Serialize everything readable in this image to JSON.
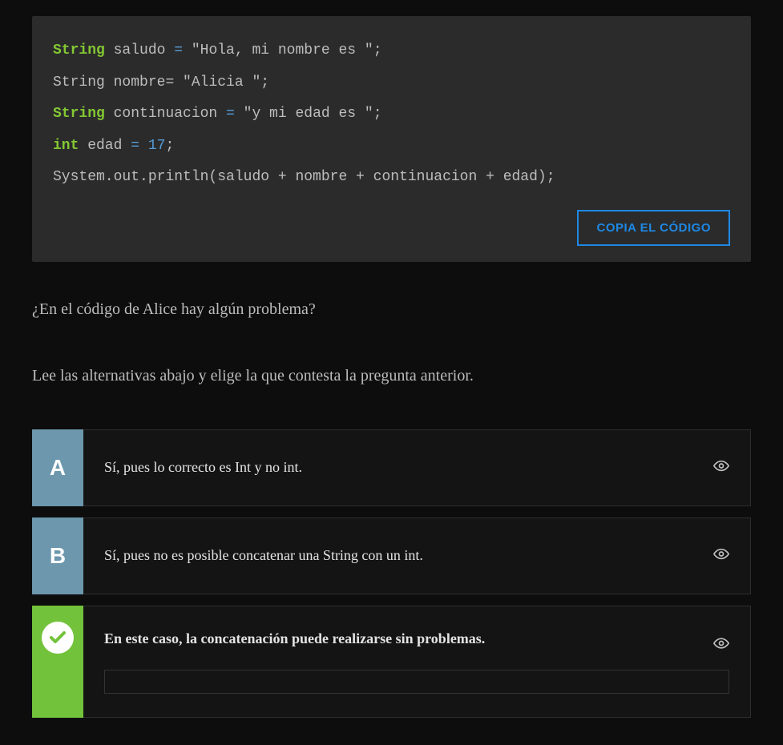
{
  "code": {
    "t_string_a": "String",
    "v_saludo": " saludo",
    "eq_a": " = ",
    "s_saludo": "\"Hola, mi nombre es \"",
    "semi": ";",
    "t_string_b": "String",
    "v_nombre": " nombre",
    "eq_plain": "= ",
    "s_nombre": "\"Alicia \"",
    "t_string_c": "String",
    "v_cont": " continuacion",
    "eq_c": " = ",
    "s_cont": "\"y mi edad es \"",
    "t_int": "int",
    "v_edad": " edad",
    "eq_d": " = ",
    "n_edad": "17",
    "println": "System.out.println(saludo + nombre + continuacion + edad);",
    "copy_label": "COPIA EL CÓDIGO"
  },
  "question": "¿En el código de Alice hay algún problema?",
  "instruction": "Lee las alternativas abajo y elige la que contesta la pregunta anterior.",
  "choices": {
    "a": {
      "letter": "A",
      "text": "Sí, pues lo correcto es Int y no int."
    },
    "b": {
      "letter": "B",
      "text": "Sí, pues no es posible concatenar una String con un int."
    },
    "c": {
      "text": "En este caso, la concatenación puede realizarse sin problemas."
    }
  }
}
